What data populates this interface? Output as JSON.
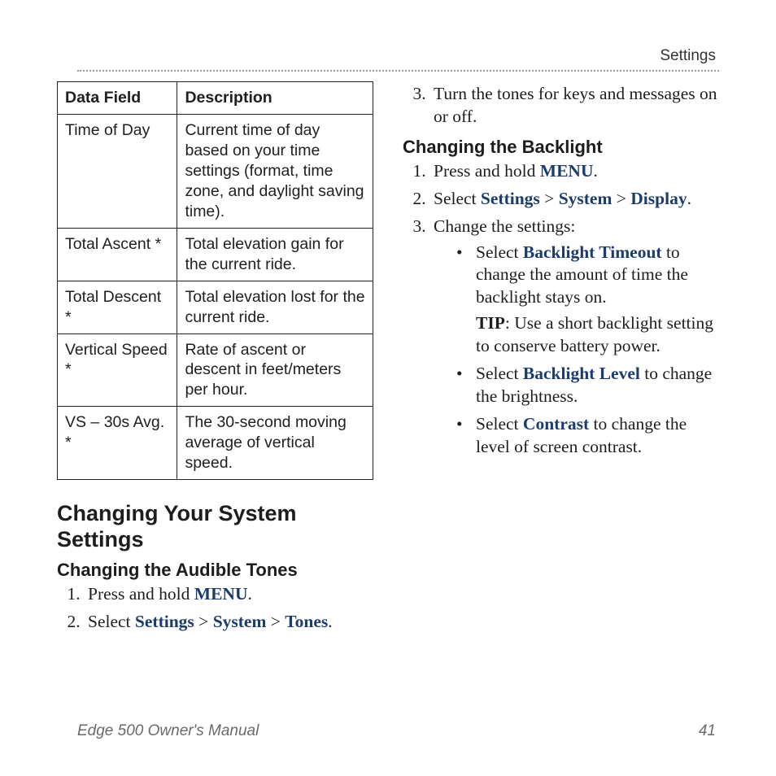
{
  "header": {
    "section": "Settings"
  },
  "table": {
    "head": {
      "field": "Data Field",
      "desc": "Description"
    },
    "rows": [
      {
        "field": "Time of Day",
        "desc": "Current time of day based on your time settings (format, time zone, and daylight saving time)."
      },
      {
        "field": "Total Ascent *",
        "desc": "Total elevation gain for the current ride."
      },
      {
        "field": "Total Descent *",
        "desc": "Total elevation lost for the current ride."
      },
      {
        "field": "Vertical Speed *",
        "desc": "Rate of ascent or descent in feet/meters per hour."
      },
      {
        "field": "VS – 30s Avg. *",
        "desc": "The 30-second moving average of vertical speed."
      }
    ]
  },
  "left": {
    "h1": "Changing Your System Settings",
    "h2_tones": "Changing the Audible Tones",
    "tones_steps": {
      "s1_a": "Press and hold ",
      "s1_menu": "MENU",
      "s1_b": ".",
      "s2_a": "Select ",
      "s2_settings": "Settings",
      "s2_gt1": " > ",
      "s2_system": "System",
      "s2_gt2": " > ",
      "s2_tones": "Tones",
      "s2_b": "."
    }
  },
  "right": {
    "tones_s3": "Turn the tones for keys and messages on or off.",
    "h2_backlight": "Changing the Backlight",
    "back_steps": {
      "s1_a": "Press and hold ",
      "s1_menu": "MENU",
      "s1_b": ".",
      "s2_a": "Select ",
      "s2_settings": "Settings",
      "s2_gt1": " > ",
      "s2_system": "System",
      "s2_gt2": " > ",
      "s2_display": "Display",
      "s2_b": ".",
      "s3": "Change the settings:"
    },
    "bullets": {
      "b1_a": "Select ",
      "b1_kw": "Backlight Timeout",
      "b1_b": " to change the amount of time the backlight stays on.",
      "tip_label": "TIP",
      "tip_body": ": Use a short backlight setting to conserve battery power.",
      "b2_a": "Select ",
      "b2_kw": "Backlight Level",
      "b2_b": " to change the brightness.",
      "b3_a": "Select ",
      "b3_kw": "Contrast",
      "b3_b": " to change the level of screen contrast."
    }
  },
  "footer": {
    "title": "Edge 500 Owner's Manual",
    "page": "41"
  }
}
